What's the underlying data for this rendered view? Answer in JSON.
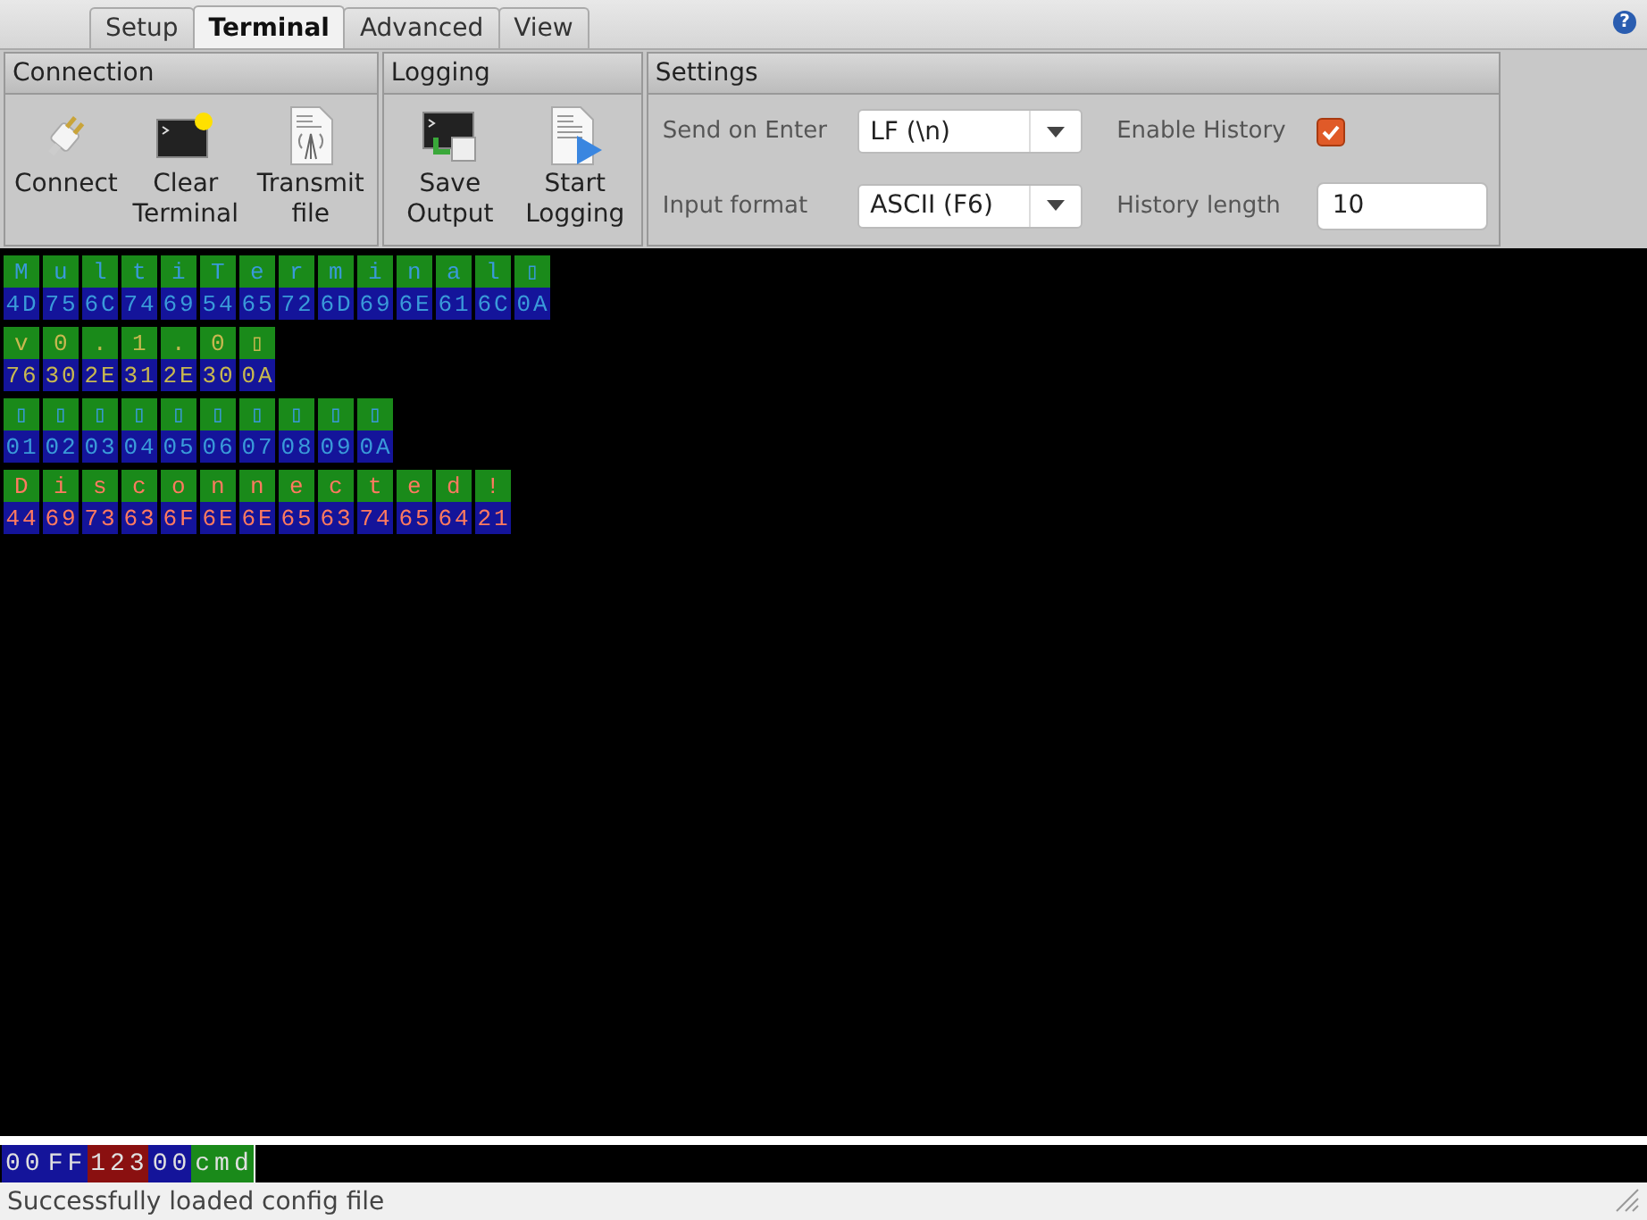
{
  "tabs": [
    {
      "label": "Setup",
      "selected": false
    },
    {
      "label": "Terminal",
      "selected": true
    },
    {
      "label": "Advanced",
      "selected": false
    },
    {
      "label": "View",
      "selected": false
    }
  ],
  "help_button": "?",
  "ribbon": [
    {
      "title": "Connection",
      "buttons": [
        {
          "label": "Connect"
        },
        {
          "label": "Clear Terminal"
        },
        {
          "label": "Transmit file"
        }
      ]
    },
    {
      "title": "Logging",
      "buttons": [
        {
          "label": "Save Output"
        },
        {
          "label": "Start Logging"
        }
      ]
    }
  ],
  "settings": {
    "title": "Settings",
    "send_on_enter": {
      "label": "Send on Enter",
      "value": "LF (\\n)"
    },
    "input_format": {
      "label": "Input format",
      "value": "ASCII (F6)"
    },
    "enable_history": {
      "label": "Enable History",
      "checked": true
    },
    "history_length": {
      "label": "History length",
      "value": "10"
    }
  },
  "terminal": {
    "lines": [
      {
        "kind": "message",
        "cells": [
          {
            "char": "M",
            "hex": "4D"
          },
          {
            "char": "u",
            "hex": "75"
          },
          {
            "char": "l",
            "hex": "6C"
          },
          {
            "char": "t",
            "hex": "74"
          },
          {
            "char": "i",
            "hex": "69"
          },
          {
            "char": "T",
            "hex": "54"
          },
          {
            "char": "e",
            "hex": "65"
          },
          {
            "char": "r",
            "hex": "72"
          },
          {
            "char": "m",
            "hex": "6D"
          },
          {
            "char": "i",
            "hex": "69"
          },
          {
            "char": "n",
            "hex": "6E"
          },
          {
            "char": "a",
            "hex": "61"
          },
          {
            "char": "l",
            "hex": "6C"
          },
          {
            "char": "▯",
            "hex": "0A"
          }
        ]
      },
      {
        "kind": "version",
        "cells": [
          {
            "char": "v",
            "hex": "76"
          },
          {
            "char": "0",
            "hex": "30"
          },
          {
            "char": ".",
            "hex": "2E"
          },
          {
            "char": "1",
            "hex": "31"
          },
          {
            "char": ".",
            "hex": "2E"
          },
          {
            "char": "0",
            "hex": "30"
          },
          {
            "char": "▯",
            "hex": "0A"
          }
        ]
      },
      {
        "kind": "data",
        "cells": [
          {
            "char": "▯",
            "hex": "01"
          },
          {
            "char": "▯",
            "hex": "02"
          },
          {
            "char": "▯",
            "hex": "03"
          },
          {
            "char": "▯",
            "hex": "04"
          },
          {
            "char": "▯",
            "hex": "05"
          },
          {
            "char": "▯",
            "hex": "06"
          },
          {
            "char": "▯",
            "hex": "07"
          },
          {
            "char": "▯",
            "hex": "08"
          },
          {
            "char": "▯",
            "hex": "09"
          },
          {
            "char": "▯",
            "hex": "0A"
          }
        ]
      },
      {
        "kind": "error",
        "cells": [
          {
            "char": "D",
            "hex": "44"
          },
          {
            "char": "i",
            "hex": "69"
          },
          {
            "char": "s",
            "hex": "73"
          },
          {
            "char": "c",
            "hex": "63"
          },
          {
            "char": "o",
            "hex": "6F"
          },
          {
            "char": "n",
            "hex": "6E"
          },
          {
            "char": "n",
            "hex": "6E"
          },
          {
            "char": "e",
            "hex": "65"
          },
          {
            "char": "c",
            "hex": "63"
          },
          {
            "char": "t",
            "hex": "74"
          },
          {
            "char": "e",
            "hex": "65"
          },
          {
            "char": "d",
            "hex": "64"
          },
          {
            "char": "!",
            "hex": "21"
          }
        ]
      }
    ]
  },
  "input_line": [
    {
      "kind": "hex",
      "text": "00"
    },
    {
      "kind": "hex",
      "text": "FF"
    },
    {
      "kind": "decimal",
      "text": "123"
    },
    {
      "kind": "hex",
      "text": "00"
    },
    {
      "kind": "text",
      "text": "cmd"
    }
  ],
  "status_bar": "Successfully loaded config file"
}
